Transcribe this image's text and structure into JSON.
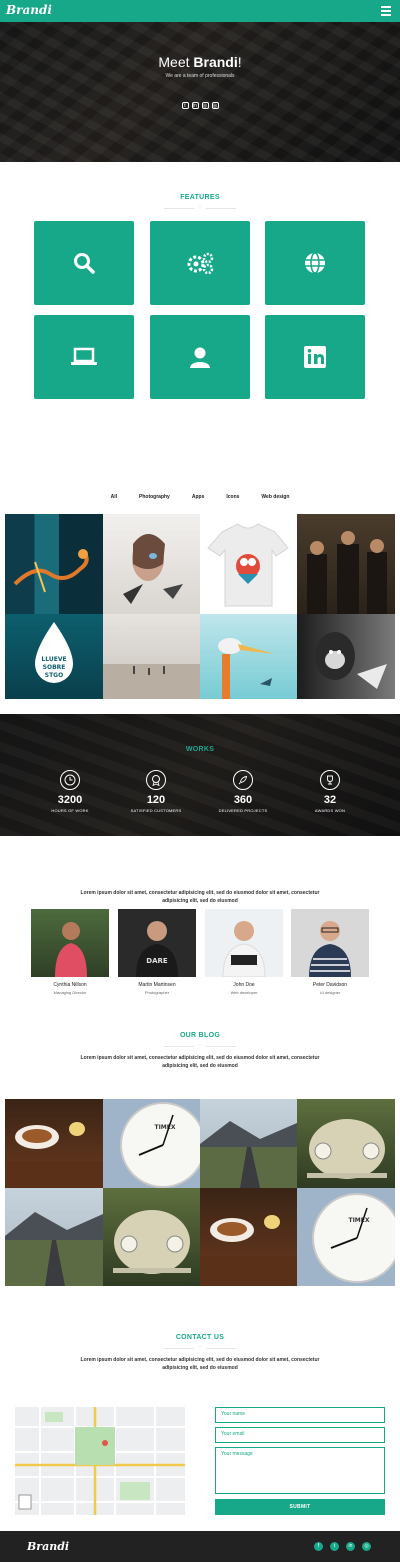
{
  "nav": {
    "brand": "Brandi"
  },
  "hero": {
    "title_pre": "Meet",
    "title_bold": "Brandi",
    "title_post": "!",
    "subtitle": "We are a team of professionals",
    "social": [
      "t",
      "in",
      "◎",
      "◎"
    ]
  },
  "features": {
    "title": "FEATURES",
    "mark": "♡",
    "icons": [
      "search-icon",
      "gears-icon",
      "globe-icon",
      "laptop-icon",
      "user-icon",
      "linkedin-icon"
    ]
  },
  "portfolio": {
    "filters": [
      "All",
      "Photography",
      "Apps",
      "Icons",
      "Web design"
    ]
  },
  "works": {
    "title": "WORKS",
    "stats": [
      {
        "value": "3200",
        "label": "HOURS OF WORK",
        "icon": "clock-icon"
      },
      {
        "value": "120",
        "label": "SATISFIED CUSTOMERS",
        "icon": "medal-icon"
      },
      {
        "value": "360",
        "label": "DELIVERED PROJECTS",
        "icon": "rocket-icon"
      },
      {
        "value": "32",
        "label": "AWARDS WON",
        "icon": "trophy-icon"
      }
    ]
  },
  "team": {
    "intro": "Lorem ipsum dolor sit amet, consectetur adipisicing elit, sed do eiusmod dolor sit amet, consectetur adipisicing elit, sed do eiusmod",
    "members": [
      {
        "name": "Cynthia Nillson",
        "role": "Managing Director"
      },
      {
        "name": "Martin Martinsen",
        "role": "Photographer"
      },
      {
        "name": "John Doe",
        "role": "Web developer"
      },
      {
        "name": "Peter Davidson",
        "role": "UI designer"
      }
    ]
  },
  "blog": {
    "title": "OUR BLOG",
    "intro": "Lorem ipsum dolor sit amet, consectetur adipisicing elit, sed do eiusmod dolor sit amet, consectetur adipisicing elit, sed do eiusmod"
  },
  "contact": {
    "title": "CONTACT US",
    "intro": "Lorem ipsum dolor sit amet, consectetur adipisicing elit, sed do eiusmod dolor sit amet, consectetur adipisicing elit, sed do eiusmod",
    "name_placeholder": "Your name",
    "email_placeholder": "Your email",
    "message_placeholder": "Your message",
    "submit": "SUBMIT"
  },
  "footer": {
    "brand": "Brandi",
    "social": [
      "f",
      "t",
      "in",
      "◎"
    ]
  },
  "colors": {
    "accent": "#17a88a",
    "dark": "#222222"
  }
}
